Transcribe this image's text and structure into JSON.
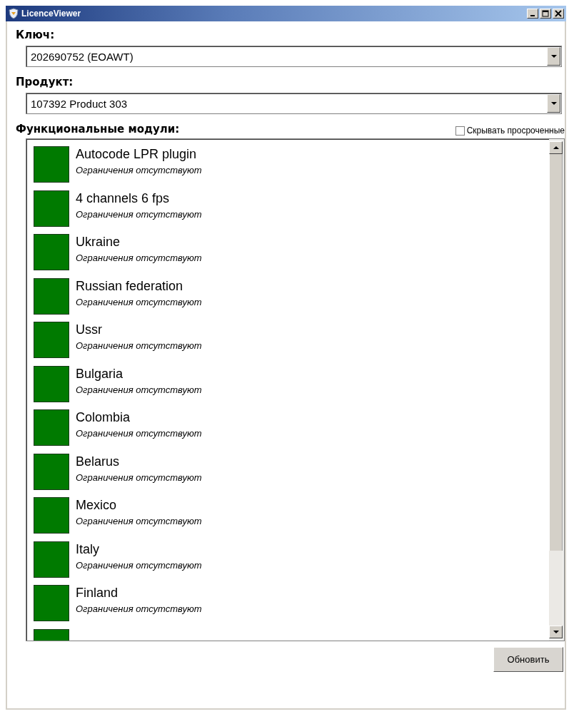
{
  "window": {
    "title": "LicenceViewer"
  },
  "key": {
    "label": "Ключ:",
    "value": "202690752 (EOAWT)"
  },
  "product": {
    "label": "Продукт:",
    "value": "107392 Product 303"
  },
  "modules_section": {
    "label": "Функциональные модули:",
    "hide_expired": {
      "label": "Скрывать просроченные",
      "checked": false
    }
  },
  "modules": [
    {
      "name": "Autocode LPR plugin",
      "restriction": "Ограничения отсутствуют"
    },
    {
      "name": "4 channels 6 fps",
      "restriction": "Ограничения отсутствуют"
    },
    {
      "name": "Ukraine",
      "restriction": "Ограничения отсутствуют"
    },
    {
      "name": "Russian federation",
      "restriction": "Ограничения отсутствуют"
    },
    {
      "name": "Ussr",
      "restriction": "Ограничения отсутствуют"
    },
    {
      "name": "Bulgaria",
      "restriction": "Ограничения отсутствуют"
    },
    {
      "name": "Colombia",
      "restriction": "Ограничения отсутствуют"
    },
    {
      "name": "Belarus",
      "restriction": "Ограничения отсутствуют"
    },
    {
      "name": "Mexico",
      "restriction": "Ограничения отсутствуют"
    },
    {
      "name": "Italy",
      "restriction": "Ограничения отсутствуют"
    },
    {
      "name": "Finland",
      "restriction": "Ограничения отсутствуют"
    }
  ],
  "more_below": true,
  "buttons": {
    "refresh": "Обновить"
  }
}
